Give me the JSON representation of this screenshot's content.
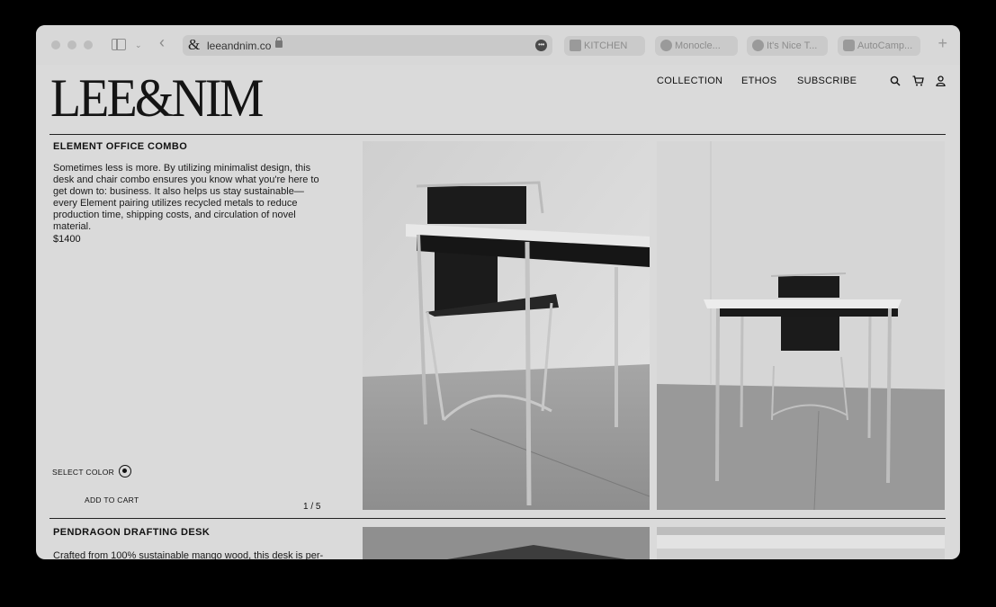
{
  "browser": {
    "url": "leeandnim.co",
    "tabs": [
      {
        "label": "KITCHEN"
      },
      {
        "label": "Monocle..."
      },
      {
        "label": "It's Nice T..."
      },
      {
        "label": "AutoCamp..."
      }
    ]
  },
  "site": {
    "logo": "LEE&NIM",
    "nav": {
      "collection": "COLLECTION",
      "ethos": "ETHOS",
      "subscribe": "SUBSCRIBE"
    }
  },
  "products": [
    {
      "title": "ELEMENT OFFICE COMBO",
      "description": "Sometimes less is more. By utilizing minimalist design, this desk and chair combo ensures you know what you're here to get down to: business. It also helps us stay sustainable—every Element pairing utilizes recycled metals to reduce production time, shipping costs, and circulation of novel material.",
      "price": "$1400",
      "select_color_label": "SELECT COLOR",
      "add_to_cart_label": "ADD TO CART",
      "pager": "1 / 5"
    },
    {
      "title": "PENDRAGON DRAFTING DESK",
      "description": "Crafted from 100% sustainable mango wood, this desk is per-"
    }
  ],
  "icons": {
    "search": "search-icon",
    "cart": "cart-icon",
    "account": "user-icon",
    "sidebar": "sidebar-icon",
    "back": "chevron-left-icon",
    "lock": "lock-icon",
    "more": "more-icon",
    "new_tab": "plus-icon"
  }
}
